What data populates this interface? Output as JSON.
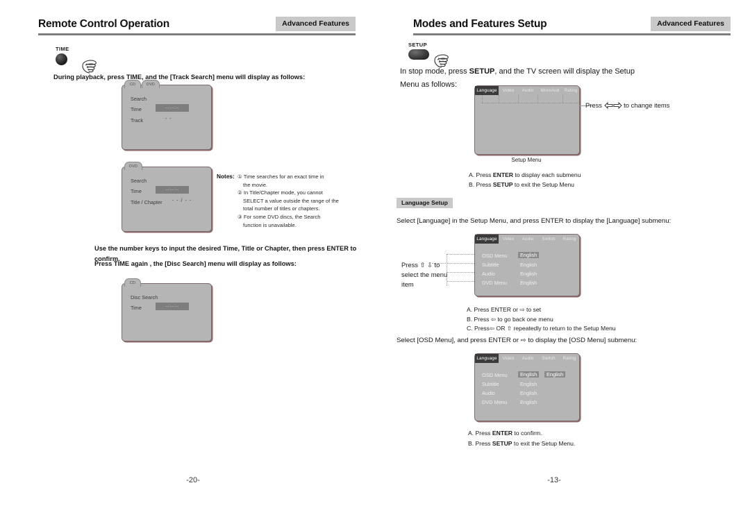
{
  "left_page": {
    "header": {
      "title": "Remote Control Operation",
      "tag": "Advanced Features"
    },
    "remote_key": {
      "label": "TIME",
      "icon": "round-button-icon",
      "hand": "hand-pointer-icon"
    },
    "intro": "During playback, press  TIME, and the [Track Search] menu will display as follows:",
    "screen1": {
      "tabs": [
        "CD",
        "DVD"
      ],
      "rows": [
        {
          "label": "Search",
          "value": ""
        },
        {
          "label": "Time",
          "value": "--:--:--",
          "highlight": true
        },
        {
          "label": "Track",
          "value": "- -"
        }
      ]
    },
    "screen2": {
      "tabs": [
        "DVD"
      ],
      "rows": [
        {
          "label": "Search",
          "value": ""
        },
        {
          "label": "Time",
          "value": "--:--:--",
          "highlight": true
        },
        {
          "label": "Title / Chapter",
          "value": "- - / - -"
        }
      ]
    },
    "notes": {
      "label": "Notes:",
      "items": [
        "① Time searches for an exact time in",
        "the movie.",
        "② In Title/Chapter mode, you cannot",
        "SELECT a value outside the range of the",
        "total number of titles or chapters.",
        "③ For some DVD discs, the Search",
        "function is unavailable."
      ]
    },
    "instruction1": "Use the number keys to input  the desired Time, Title or Chapter, then press ENTER to confirm.",
    "instruction2": "Press  TIME again , the [Disc Search] menu will display as follows:",
    "screen3": {
      "tabs": [
        "CD"
      ],
      "rows": [
        {
          "label": "Disc Search",
          "value": ""
        },
        {
          "label": "Time",
          "value": "--:--:--",
          "highlight": true
        }
      ]
    },
    "page_number": "-20-"
  },
  "right_page": {
    "header": {
      "title": "Modes and Features Setup",
      "tag": "Advanced Features"
    },
    "remote_key": {
      "label": "SETUP",
      "icon": "oval-button-icon",
      "hand": "hand-pointer-icon"
    },
    "intro_line1_a": "In stop mode, press ",
    "intro_line1_b": "SETUP",
    "intro_line1_c": ", and the TV screen will display the Setup",
    "intro_line2": "Menu as follows:",
    "setup_menu": {
      "tabs": [
        "Language",
        "Video",
        "Audio",
        "MoreAud",
        "Rating"
      ],
      "selected_tab": "Language",
      "caption": "Setup Menu"
    },
    "callout_change_items": {
      "pre": "Press ",
      "left_arrow": "left-arrow-icon",
      "right_arrow": "right-arrow-icon",
      "post": " to change items"
    },
    "list1": [
      {
        "letter": "A.",
        "pre": "Press ",
        "strong": "ENTER",
        "post": " to display each submenu"
      },
      {
        "letter": "B.",
        "pre": "Press ",
        "strong": "SETUP",
        "post": " to exit the Setup Menu"
      }
    ],
    "badge": "Language Setup",
    "select_language_text": "Select [Language] in the Setup Menu, and press ENTER to display the [Language] submenu:",
    "callout_select_item": [
      "Press ⇧ ⇩  to",
      "select the menu",
      "item"
    ],
    "language_menu": {
      "tabs": [
        "Language",
        "Video",
        "Audio",
        "Switch",
        "Rating"
      ],
      "selected_tab": "Language",
      "items": [
        {
          "label": "OSD Menu",
          "value": "English",
          "highlight": true
        },
        {
          "label": "Subtitle",
          "value": "English",
          "highlight": false
        },
        {
          "label": "Audio",
          "value": "English",
          "highlight": false
        },
        {
          "label": "DVD Menu",
          "value": "English",
          "highlight": false
        }
      ]
    },
    "list2": [
      {
        "letter": "A.",
        "text": "Press ENTER or ⇨ to set"
      },
      {
        "letter": "B.",
        "text": "Press ⇦  to go back one menu"
      },
      {
        "letter": "C.",
        "text": "Press⇦  OR  ⇧  repeatedly to return to the Setup Menu"
      }
    ],
    "select_osd_text": "Select [OSD Menu], and press ENTER or ⇨ to display the [OSD Menu] submenu:",
    "osd_menu": {
      "tabs": [
        "Language",
        "Video",
        "Audio",
        "Switch",
        "Rating"
      ],
      "selected_tab": "Language",
      "items": [
        {
          "label": "OSD Menu",
          "value": "English",
          "highlight": true,
          "value2": "English",
          "highlight2": true
        },
        {
          "label": "Subtitle",
          "value": "English",
          "highlight": false
        },
        {
          "label": "Audio",
          "value": "English",
          "highlight": false
        },
        {
          "label": "DVD Menu",
          "value": "English",
          "highlight": false
        }
      ]
    },
    "list3": [
      {
        "letter": "A.",
        "pre": "Press ",
        "strong": "ENTER",
        "post": " to confirm."
      },
      {
        "letter": "B.",
        "pre": "Press ",
        "strong": "SETUP",
        "post": " to exit the Setup Menu."
      }
    ],
    "page_number": "-13-"
  },
  "colors": {
    "tv_screen": "#b5b5b5",
    "tag_bg": "#c9c9c9",
    "rule": "#7d7d7d",
    "highlight": "#8a8a8a",
    "selected_tab": "#3a3a3a"
  }
}
